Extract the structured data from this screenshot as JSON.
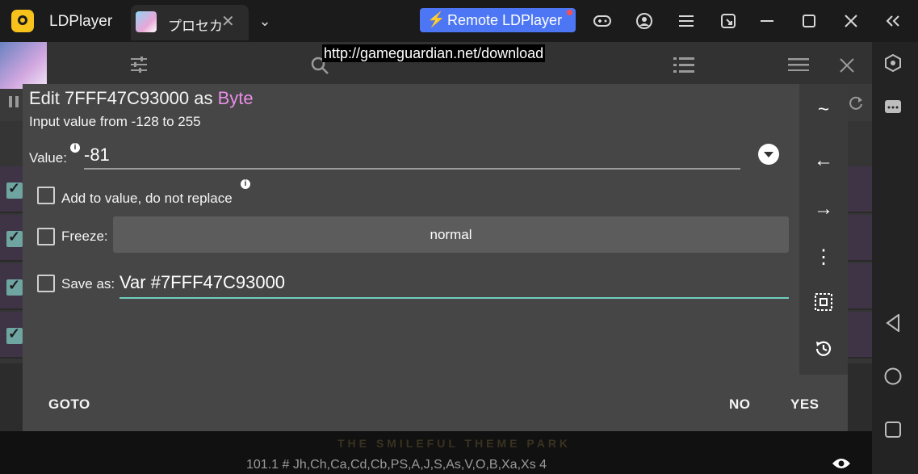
{
  "titlebar": {
    "app_name": "LDPlayer",
    "tab_label": "プロセカ",
    "tab_close": "✕",
    "tab_dropdown": "⌄",
    "remote_label": "Remote LDPlayer",
    "remote_icon": "⚡",
    "accent": "#4d76f4"
  },
  "overlay": {
    "url": "http://gameguardian.net/download"
  },
  "dialog": {
    "title_prefix": "Edit 7FFF47C93000 as ",
    "title_type": "Byte",
    "range": "Input value from -128 to 255",
    "value_label": "Value:",
    "value": "-81",
    "add_label": "Add to value, do not replace",
    "freeze_label": "Freeze:",
    "freeze_mode": "normal",
    "saveas_label": "Save as:",
    "saveas_value": "Var #7FFF47C93000",
    "goto_label": "GOTO",
    "no_label": "NO",
    "yes_label": "YES",
    "side_icons": [
      "~",
      "←",
      "→",
      "⋮",
      "⧈",
      "⟲"
    ]
  },
  "game": {
    "theme_text": "THE SMILEFUL THEME PARK",
    "footer_text": "101.1 # Jh,Ch,Ca,Cd,Cb,PS,A,J,S,As,V,O,B,Xa,Xs 4"
  }
}
